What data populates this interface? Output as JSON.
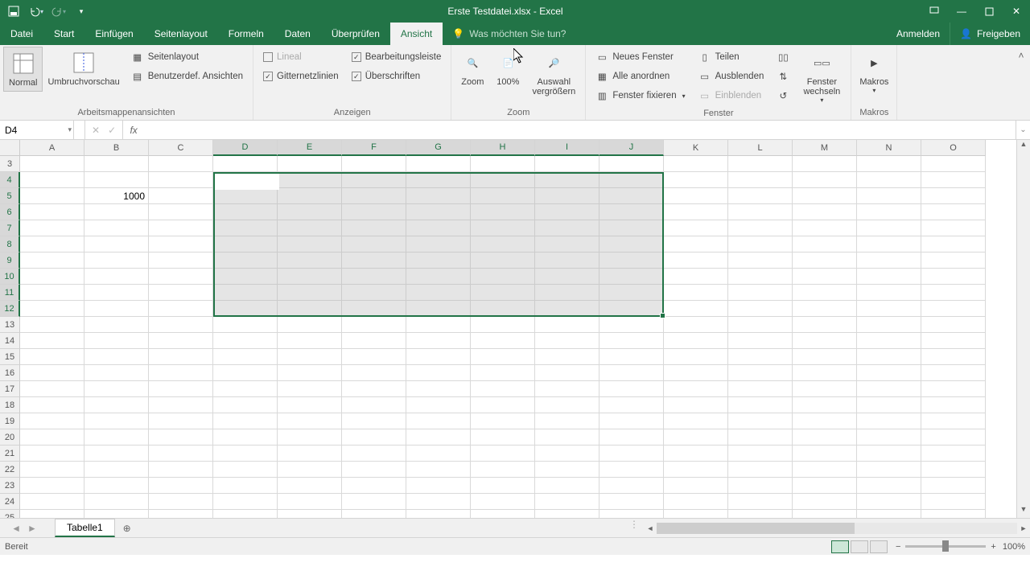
{
  "title": "Erste Testdatei.xlsx - Excel",
  "qat": {
    "save": "save",
    "undo": "undo",
    "redo": "redo"
  },
  "tabs": {
    "file": "Datei",
    "items": [
      "Start",
      "Einfügen",
      "Seitenlayout",
      "Formeln",
      "Daten",
      "Überprüfen",
      "Ansicht"
    ],
    "active": "Ansicht",
    "tellme_placeholder": "Was möchten Sie tun?",
    "signin": "Anmelden",
    "share": "Freigeben"
  },
  "ribbon": {
    "group1": {
      "label": "Arbeitsmappenansichten",
      "normal": "Normal",
      "umbruch": "Umbruchvorschau",
      "seitenlayout": "Seitenlayout",
      "benutz": "Benutzerdef. Ansichten"
    },
    "group2": {
      "label": "Anzeigen",
      "lineal": "Lineal",
      "bearb": "Bearbeitungsleiste",
      "gitter": "Gitternetzlinien",
      "ueber": "Überschriften"
    },
    "group3": {
      "label": "Zoom",
      "zoom": "Zoom",
      "p100": "100%",
      "auswahl": "Auswahl vergrößern"
    },
    "group4": {
      "label": "Fenster",
      "neu": "Neues Fenster",
      "alle": "Alle anordnen",
      "fix": "Fenster fixieren",
      "teilen": "Teilen",
      "ausbl": "Ausblenden",
      "einbl": "Einblenden",
      "wechseln": "Fenster wechseln"
    },
    "group5": {
      "label": "Makros",
      "makros": "Makros"
    }
  },
  "namebox": "D4",
  "formula": "",
  "columns": [
    "A",
    "B",
    "C",
    "D",
    "E",
    "F",
    "G",
    "H",
    "I",
    "J",
    "K",
    "L",
    "M",
    "N",
    "O"
  ],
  "rows": [
    3,
    4,
    5,
    6,
    7,
    8,
    9,
    10,
    11,
    12,
    13,
    14,
    15,
    16,
    17,
    18,
    19,
    20,
    21,
    22,
    23,
    24,
    25
  ],
  "cell_b5": "1000",
  "sheet": "Tabelle1",
  "status": {
    "ready": "Bereit",
    "zoom": "100%"
  },
  "chart_data": {
    "type": "table",
    "selection": "D4:J12",
    "active_cell": "D4",
    "cells": {
      "B5": 1000
    }
  }
}
